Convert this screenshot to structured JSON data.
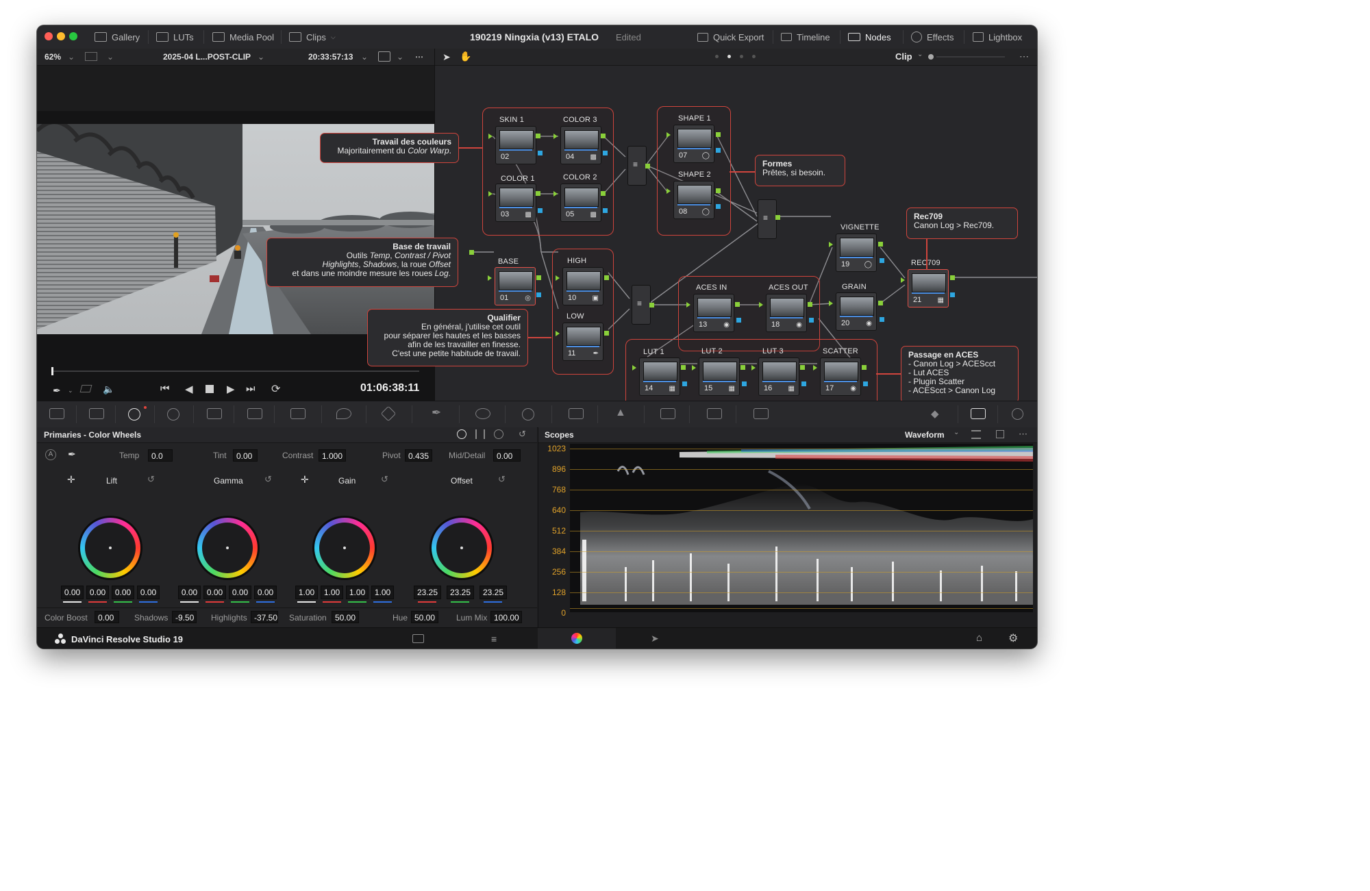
{
  "window": {
    "title": "190219 Ningxia (v13) ETALO",
    "edited_label": "Edited",
    "traffic_light_colors": [
      "#ff5f57",
      "#febc2e",
      "#28c840"
    ]
  },
  "toolbar_left": {
    "gallery": "Gallery",
    "luts": "LUTs",
    "media_pool": "Media Pool",
    "clips": "Clips"
  },
  "toolbar_right": {
    "quick_export": "Quick Export",
    "timeline": "Timeline",
    "nodes": "Nodes",
    "effects": "Effects",
    "lightbox": "Lightbox"
  },
  "viewer": {
    "zoom": "62%",
    "clip_name": "2025-04 L...POST-CLIP",
    "source_timecode": "20:33:57:13",
    "record_timecode": "01:06:38:11"
  },
  "node_editor": {
    "mode": "Clip",
    "nodes": [
      {
        "label": "SKIN 1",
        "num": "02"
      },
      {
        "label": "COLOR 3",
        "num": "04"
      },
      {
        "label": "COLOR 1",
        "num": "03"
      },
      {
        "label": "COLOR 2",
        "num": "05"
      },
      {
        "label": "SHAPE 1",
        "num": "07"
      },
      {
        "label": "SHAPE 2",
        "num": "08"
      },
      {
        "label": "BASE",
        "num": "01"
      },
      {
        "label": "HIGH",
        "num": "10"
      },
      {
        "label": "LOW",
        "num": "11"
      },
      {
        "label": "ACES IN",
        "num": "13"
      },
      {
        "label": "ACES OUT",
        "num": "18"
      },
      {
        "label": "VIGNETTE",
        "num": "19"
      },
      {
        "label": "GRAIN",
        "num": "20"
      },
      {
        "label": "REC709",
        "num": "21"
      },
      {
        "label": "LUT 1",
        "num": "14"
      },
      {
        "label": "LUT 2",
        "num": "15"
      },
      {
        "label": "LUT 3",
        "num": "16"
      },
      {
        "label": "SCATTER",
        "num": "17"
      }
    ],
    "notes": {
      "couleurs": {
        "title": "Travail des couleurs",
        "line1": "Majoritairement du ",
        "em1": "Color Warp",
        "tail1": "."
      },
      "formes": {
        "title": "Formes",
        "line1": "Prêtes, si besoin."
      },
      "rec709": {
        "title": "Rec709",
        "line1": "Canon Log > Rec709."
      },
      "base": {
        "title": "Base de travail",
        "l1a": "Outils ",
        "l1b": "Temp",
        "l1c": ", ",
        "l1d": "Contrast / Pivot",
        "l2a": "Highlights",
        "l2b": ", ",
        "l2c": "Shadows",
        "l2d": ", la roue ",
        "l2e": "Offset",
        "l3a": "et dans une moindre mesure les roues ",
        "l3b": "Log",
        "l3c": "."
      },
      "qualifier": {
        "title": "Qualifier",
        "line1": "En général, j'utilise cet outil",
        "line2": "pour séparer les hautes et les basses",
        "line3": "afin de les travailler en finesse.",
        "line4": "C'est une petite habitude de travail."
      },
      "aces": {
        "title": "Passage en ACES",
        "line1": "- Canon Log > ACEScct",
        "line2": "- Lut ACES",
        "line3": "- Plugin Scatter",
        "line4": "- ACEScct > Canon Log"
      }
    }
  },
  "primaries": {
    "title": "Primaries - Color Wheels",
    "temp_label": "Temp",
    "temp": "0.0",
    "tint_label": "Tint",
    "tint": "0.00",
    "contrast_label": "Contrast",
    "contrast": "1.000",
    "pivot_label": "Pivot",
    "pivot": "0.435",
    "middetail_label": "Mid/Detail",
    "middetail": "0.00",
    "wheels": [
      {
        "name": "Lift",
        "values": [
          "0.00",
          "0.00",
          "0.00",
          "0.00"
        ]
      },
      {
        "name": "Gamma",
        "values": [
          "0.00",
          "0.00",
          "0.00",
          "0.00"
        ]
      },
      {
        "name": "Gain",
        "values": [
          "1.00",
          "1.00",
          "1.00",
          "1.00"
        ]
      },
      {
        "name": "Offset",
        "values": [
          "23.25",
          "23.25",
          "23.25"
        ]
      }
    ],
    "colorboost_label": "Color Boost",
    "colorboost": "0.00",
    "shadows_label": "Shadows",
    "shadows": "-9.50",
    "highlights_label": "Highlights",
    "highlights": "-37.50",
    "saturation_label": "Saturation",
    "saturation": "50.00",
    "hue_label": "Hue",
    "hue": "50.00",
    "lummix_label": "Lum Mix",
    "lummix": "100.00"
  },
  "scopes": {
    "title": "Scopes",
    "mode": "Waveform",
    "y_ticks": [
      "1023",
      "896",
      "768",
      "640",
      "512",
      "384",
      "256",
      "128",
      "0"
    ]
  },
  "status": {
    "app_name": "DaVinci Resolve Studio 19"
  },
  "colors": {
    "accent_red": "#d0453d",
    "pin_green": "#8ad03a",
    "pin_blue": "#2ea6e0",
    "scope_tick": "#e0a22a"
  }
}
